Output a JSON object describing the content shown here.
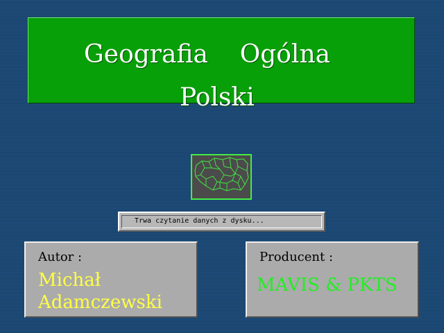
{
  "title": {
    "line1": "Geografia    Ogólna",
    "line2": "Polski"
  },
  "status": {
    "text": "Trwa czytanie danych z dysku..."
  },
  "author": {
    "label": "Autor :",
    "first_name": "Michał",
    "last_name": "Adamczewski"
  },
  "producer": {
    "label": "Producent :",
    "name": "MAVIS & PKTS"
  },
  "colors": {
    "background": "#1f4f7f",
    "title_panel": "#08a008",
    "map_border": "#44ee44",
    "author_text": "#ffff44",
    "producer_text": "#22ee22"
  },
  "icons": {
    "map": "poland-map-icon"
  }
}
